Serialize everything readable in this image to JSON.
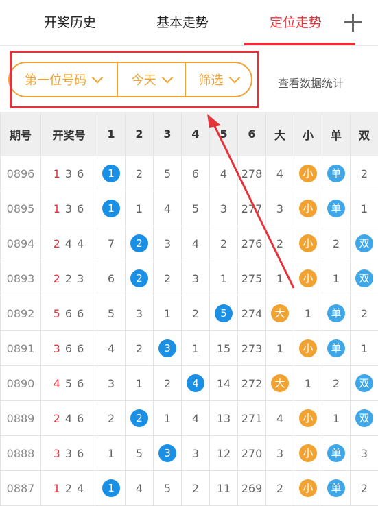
{
  "tabs": [
    {
      "label": "开奖历史",
      "active": false
    },
    {
      "label": "基本走势",
      "active": false
    },
    {
      "label": "定位走势",
      "active": true
    }
  ],
  "filters": {
    "position": "第一位号码",
    "date": "今天",
    "filter": "筛选"
  },
  "stats_link": "查看数据统计",
  "colors": {
    "accent": "#e5333b",
    "orange": "#f0a332",
    "blue": "#1a8fe3"
  },
  "table": {
    "headers": [
      "期号",
      "开奖号",
      "1",
      "2",
      "3",
      "4",
      "5",
      "6",
      "大",
      "小",
      "单",
      "双"
    ],
    "rows": [
      {
        "period": "0896",
        "lead": "1",
        "rest": "3 6",
        "cells": [
          {
            "t": "1",
            "b": "blue"
          },
          {
            "t": "2"
          },
          {
            "t": "5"
          },
          {
            "t": "6"
          },
          {
            "t": "4"
          },
          {
            "t": "278"
          },
          {
            "t": "4"
          },
          {
            "t": "小",
            "b": "orange"
          },
          {
            "t": "单",
            "b": "lblue"
          },
          {
            "t": "2"
          }
        ]
      },
      {
        "period": "0895",
        "lead": "1",
        "rest": "3 6",
        "cells": [
          {
            "t": "1",
            "b": "blue"
          },
          {
            "t": "1"
          },
          {
            "t": "4"
          },
          {
            "t": "5"
          },
          {
            "t": "3"
          },
          {
            "t": "277"
          },
          {
            "t": "3"
          },
          {
            "t": "小",
            "b": "orange"
          },
          {
            "t": "单",
            "b": "lblue"
          },
          {
            "t": "1"
          }
        ]
      },
      {
        "period": "0894",
        "lead": "2",
        "rest": "4 4",
        "cells": [
          {
            "t": "7"
          },
          {
            "t": "2",
            "b": "blue"
          },
          {
            "t": "3"
          },
          {
            "t": "4"
          },
          {
            "t": "2"
          },
          {
            "t": "276"
          },
          {
            "t": "2"
          },
          {
            "t": "小",
            "b": "orange"
          },
          {
            "t": "2"
          },
          {
            "t": "双",
            "b": "lblue"
          }
        ]
      },
      {
        "period": "0893",
        "lead": "2",
        "rest": "2 3",
        "cells": [
          {
            "t": "6"
          },
          {
            "t": "2",
            "b": "blue"
          },
          {
            "t": "2"
          },
          {
            "t": "3"
          },
          {
            "t": "1"
          },
          {
            "t": "275"
          },
          {
            "t": "1"
          },
          {
            "t": "小",
            "b": "orange"
          },
          {
            "t": "1"
          },
          {
            "t": "双",
            "b": "lblue"
          }
        ]
      },
      {
        "period": "0892",
        "lead": "5",
        "rest": "6 6",
        "cells": [
          {
            "t": "5"
          },
          {
            "t": "3"
          },
          {
            "t": "1"
          },
          {
            "t": "2"
          },
          {
            "t": "5",
            "b": "blue"
          },
          {
            "t": "274"
          },
          {
            "t": "大",
            "b": "orange"
          },
          {
            "t": "1"
          },
          {
            "t": "单",
            "b": "lblue"
          },
          {
            "t": "2"
          }
        ]
      },
      {
        "period": "0891",
        "lead": "3",
        "rest": "6 6",
        "cells": [
          {
            "t": "4"
          },
          {
            "t": "2"
          },
          {
            "t": "3",
            "b": "blue"
          },
          {
            "t": "1"
          },
          {
            "t": "15"
          },
          {
            "t": "273"
          },
          {
            "t": "1"
          },
          {
            "t": "小",
            "b": "orange"
          },
          {
            "t": "单",
            "b": "lblue"
          },
          {
            "t": "1"
          }
        ]
      },
      {
        "period": "0890",
        "lead": "4",
        "rest": "5 6",
        "cells": [
          {
            "t": "3"
          },
          {
            "t": "1"
          },
          {
            "t": "2"
          },
          {
            "t": "4",
            "b": "blue"
          },
          {
            "t": "14"
          },
          {
            "t": "272"
          },
          {
            "t": "大",
            "b": "orange"
          },
          {
            "t": "1"
          },
          {
            "t": "2"
          },
          {
            "t": "双",
            "b": "lblue"
          }
        ]
      },
      {
        "period": "0889",
        "lead": "2",
        "rest": "4 6",
        "cells": [
          {
            "t": "2"
          },
          {
            "t": "2",
            "b": "blue"
          },
          {
            "t": "1"
          },
          {
            "t": "4"
          },
          {
            "t": "13"
          },
          {
            "t": "271"
          },
          {
            "t": "4"
          },
          {
            "t": "小",
            "b": "orange"
          },
          {
            "t": "1"
          },
          {
            "t": "双",
            "b": "lblue"
          }
        ]
      },
      {
        "period": "0888",
        "lead": "3",
        "rest": "3 6",
        "cells": [
          {
            "t": "1"
          },
          {
            "t": "5"
          },
          {
            "t": "3",
            "b": "blue"
          },
          {
            "t": "3"
          },
          {
            "t": "12"
          },
          {
            "t": "270"
          },
          {
            "t": "3"
          },
          {
            "t": "小",
            "b": "orange"
          },
          {
            "t": "单",
            "b": "lblue"
          },
          {
            "t": "3"
          }
        ]
      },
      {
        "period": "0887",
        "lead": "1",
        "rest": "2 4",
        "cells": [
          {
            "t": "1",
            "b": "blue"
          },
          {
            "t": "4"
          },
          {
            "t": "5"
          },
          {
            "t": "2"
          },
          {
            "t": "11"
          },
          {
            "t": "269"
          },
          {
            "t": "2"
          },
          {
            "t": "小",
            "b": "orange"
          },
          {
            "t": "单",
            "b": "lblue"
          },
          {
            "t": "2"
          }
        ]
      }
    ]
  }
}
